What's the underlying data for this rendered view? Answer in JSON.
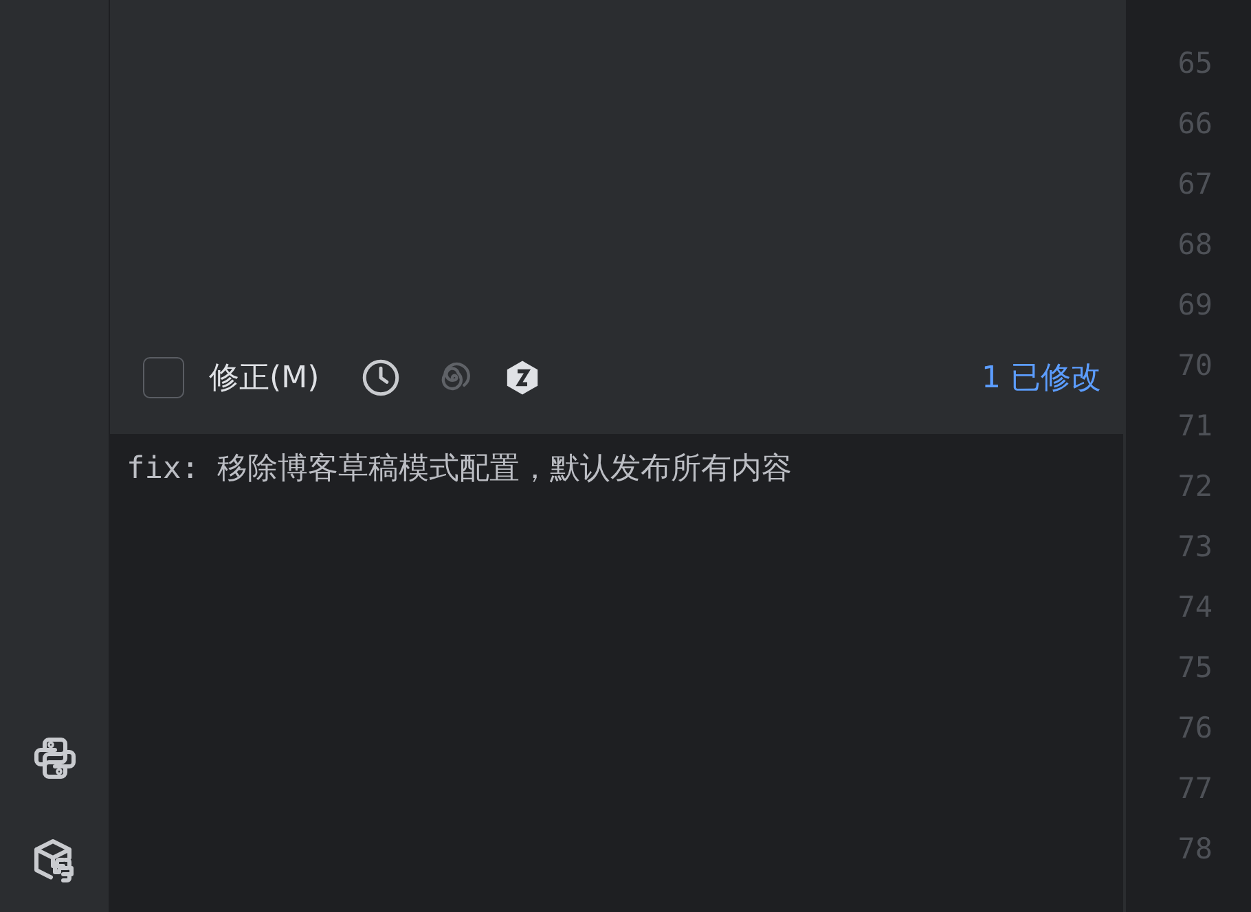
{
  "commit_panel": {
    "amend": {
      "label": "修正(M)",
      "checked": false
    },
    "changes": "1 已修改",
    "message": "fix: 移除博客草稿模式配置，默认发布所有内容"
  },
  "gutter": {
    "line_numbers": [
      "65",
      "66",
      "67",
      "68",
      "69",
      "70",
      "71",
      "72",
      "73",
      "74",
      "75",
      "76",
      "77",
      "78"
    ]
  }
}
